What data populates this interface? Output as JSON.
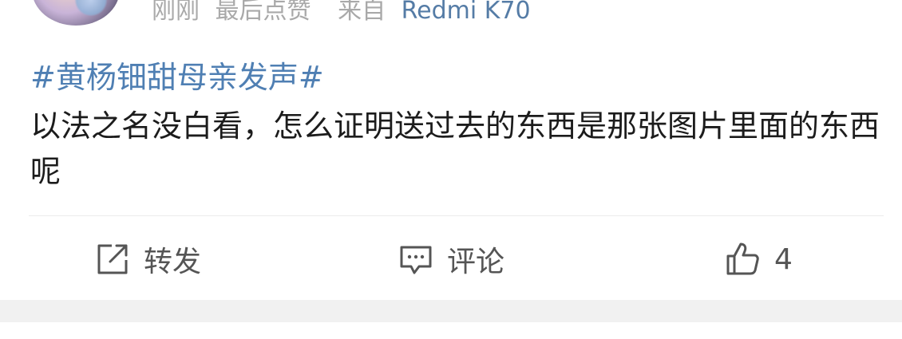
{
  "post": {
    "meta": {
      "time": "刚刚",
      "last_like": "最后点赞",
      "source_prefix": "来自",
      "device": "Redmi K70"
    },
    "topic": "#黄杨钿甜母亲发声#",
    "content": "以法之名没白看，怎么证明送过去的东西是那张图片里面的东西呢"
  },
  "actions": {
    "repost": {
      "label": "转发",
      "icon": "share-icon"
    },
    "comment": {
      "label": "评论",
      "icon": "comment-icon"
    },
    "like": {
      "count": "4",
      "icon": "thumbs-up-icon"
    }
  },
  "colors": {
    "link": "#4f7fb3",
    "meta": "#a9a9a9",
    "device": "#557ca6",
    "text": "#1c1c1c",
    "action": "#555555",
    "separator": "#f1f1f1"
  }
}
